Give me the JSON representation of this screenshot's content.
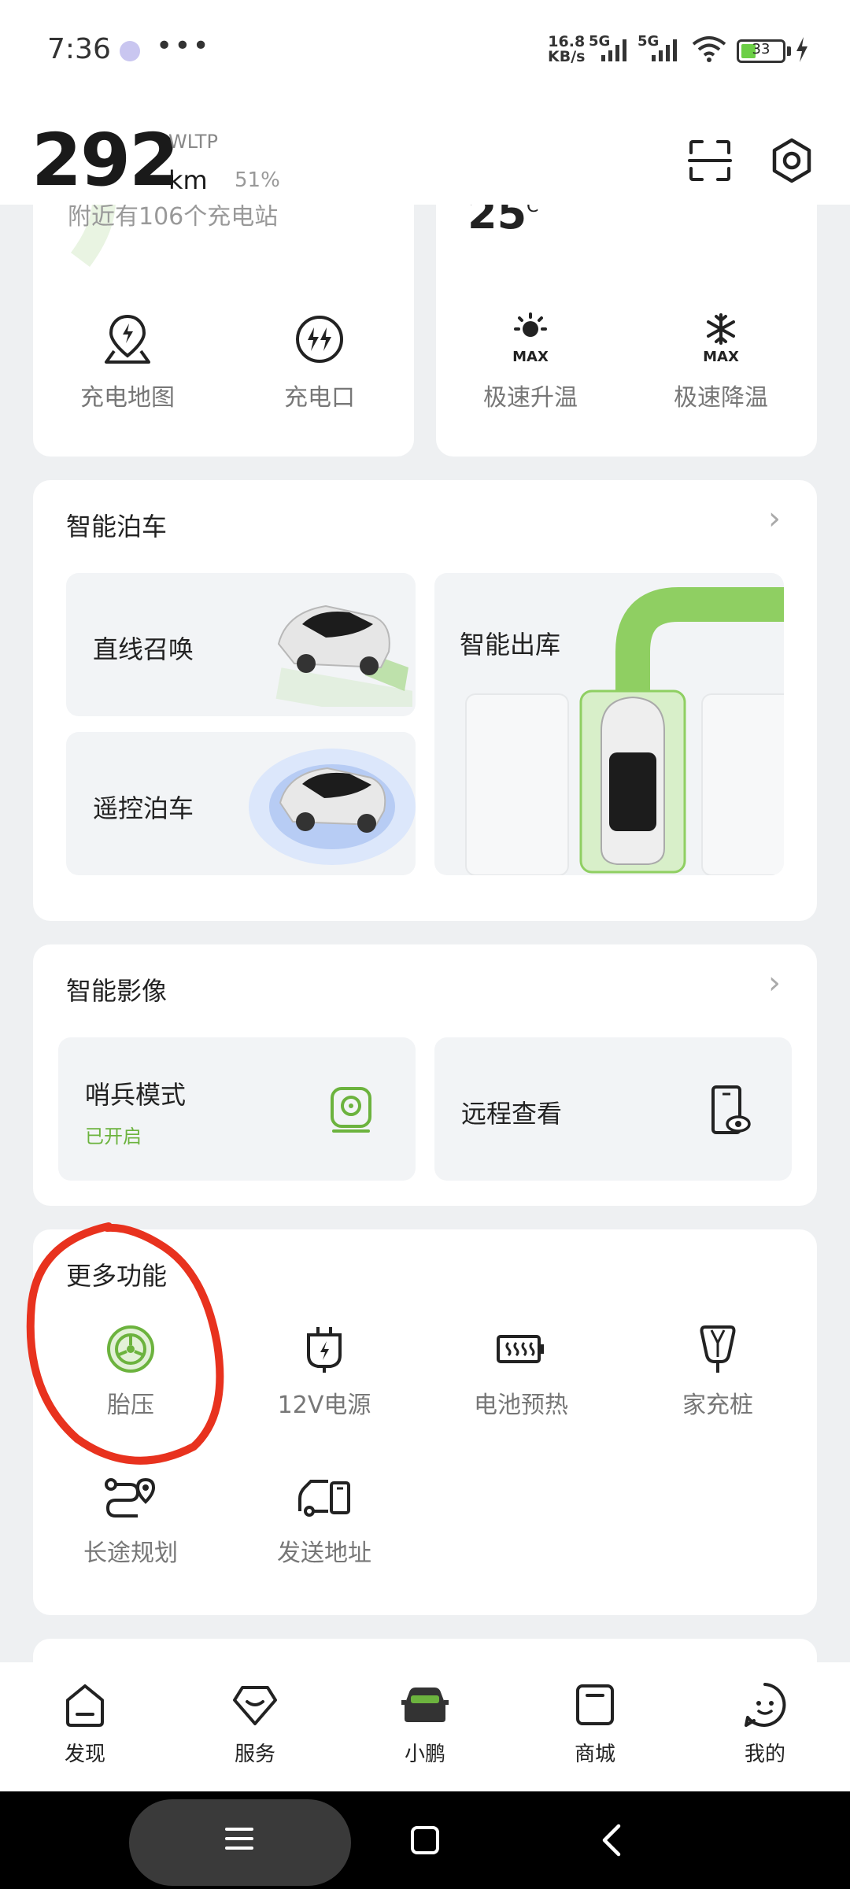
{
  "status_bar": {
    "time": "7:36",
    "more": "•••",
    "speed_value": "16.8",
    "speed_unit": "KB/s",
    "net1": "5G",
    "net2": "5G",
    "battery": "33"
  },
  "header": {
    "range": "292",
    "standard": "WLTP",
    "unit": "km",
    "battery_pct": "51%"
  },
  "charge_card": {
    "hint": "附近有106个充电站",
    "items": [
      {
        "label": "充电地图",
        "icon": "charge-map-icon"
      },
      {
        "label": "充电口",
        "icon": "charge-port-icon"
      }
    ]
  },
  "climate_card": {
    "temperature": "25",
    "temp_unit": "°C",
    "items": [
      {
        "label": "极速升温",
        "icon": "max-heat-icon"
      },
      {
        "label": "极速降温",
        "icon": "max-cool-icon"
      }
    ],
    "max_text": "MAX"
  },
  "parking": {
    "title": "智能泊车",
    "tiles": {
      "summon": "直线召唤",
      "remote": "遥控泊车",
      "exit": "智能出库"
    }
  },
  "camera": {
    "title": "智能影像",
    "sentry_label": "哨兵模式",
    "sentry_status": "已开启",
    "remote_view": "远程查看"
  },
  "more": {
    "title": "更多功能",
    "items": [
      {
        "label": "胎压",
        "icon": "tire-pressure-icon"
      },
      {
        "label": "12V电源",
        "icon": "12v-power-icon"
      },
      {
        "label": "电池预热",
        "icon": "battery-preheat-icon"
      },
      {
        "label": "家充桩",
        "icon": "home-charger-icon"
      },
      {
        "label": "长途规划",
        "icon": "route-planning-icon"
      },
      {
        "label": "发送地址",
        "icon": "send-address-icon"
      }
    ]
  },
  "bottom_nav": [
    {
      "label": "发现",
      "icon": "discover-icon"
    },
    {
      "label": "服务",
      "icon": "service-icon"
    },
    {
      "label": "小鹏",
      "icon": "car-icon"
    },
    {
      "label": "商城",
      "icon": "mall-icon"
    },
    {
      "label": "我的",
      "icon": "profile-icon"
    }
  ],
  "colors": {
    "accent_green": "#6cb33e",
    "highlight_red": "#e8321e"
  }
}
